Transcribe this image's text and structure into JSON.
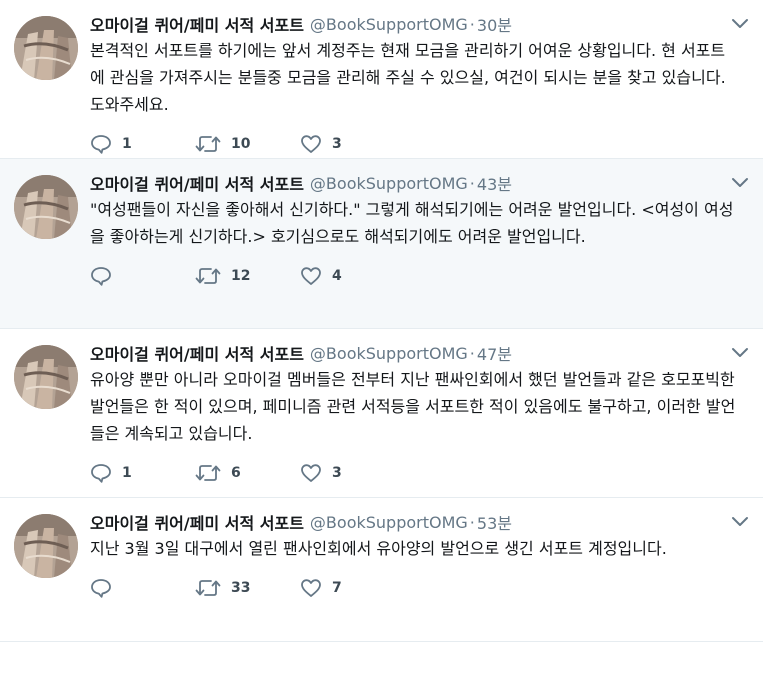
{
  "tweets": [
    {
      "name": "오마이걸 퀴어/페미 서적 서포트",
      "handle": "@BookSupportOMG",
      "dot": "·",
      "time": "30분",
      "text": "본격적인 서포트를 하기에는 앞서 계정주는 현재 모금을 관리하기 어여운 상황입니다. 현 서포트에 관심을 가져주시는 분들중 모금을 관리해 주실 수 있으실, 여건이 되시는 분을 찾고 있습니다. 도와주세요.",
      "replies": "1",
      "retweets": "10",
      "likes": "3"
    },
    {
      "name": "오마이걸 퀴어/페미 서적 서포트",
      "handle": "@BookSupportOMG",
      "dot": "·",
      "time": "43분",
      "text": "\"여성팬들이 자신을 좋아해서 신기하다.\" 그렇게 해석되기에는 어려운 발언입니다. <여성이 여성을 좋아하는게 신기하다.> 호기심으로도 해석되기에도 어려운 발언입니다.",
      "replies": "",
      "retweets": "12",
      "likes": "4"
    },
    {
      "name": "오마이걸 퀴어/페미 서적 서포트",
      "handle": "@BookSupportOMG",
      "dot": "·",
      "time": "47분",
      "text": "유아양 뿐만 아니라 오마이걸 멤버들은 전부터 지난 팬싸인회에서 했던 발언들과 같은 호모포빅한 발언들은 한 적이 있으며, 페미니즘 관련 서적등을 서포트한 적이 있음에도 불구하고, 이러한 발언들은 계속되고 있습니다.",
      "replies": "1",
      "retweets": "6",
      "likes": "3"
    },
    {
      "name": "오마이걸 퀴어/페미 서적 서포트",
      "handle": "@BookSupportOMG",
      "dot": "·",
      "time": "53분",
      "text": "지난 3월 3일 대구에서 열린 팬사인회에서 유아양의 발언으로 생긴 서포트 계정입니다.",
      "replies": "",
      "retweets": "33",
      "likes": "7"
    }
  ],
  "icons": {
    "reply": "speech-bubble-icon",
    "retweet": "retweet-arrows-icon",
    "like": "heart-outline-icon",
    "menu": "chevron-down-icon"
  },
  "colors": {
    "text": "#14171a",
    "secondary": "#657786",
    "divider": "#e6ecf0",
    "highlight_bg": "#f5f8fa"
  }
}
